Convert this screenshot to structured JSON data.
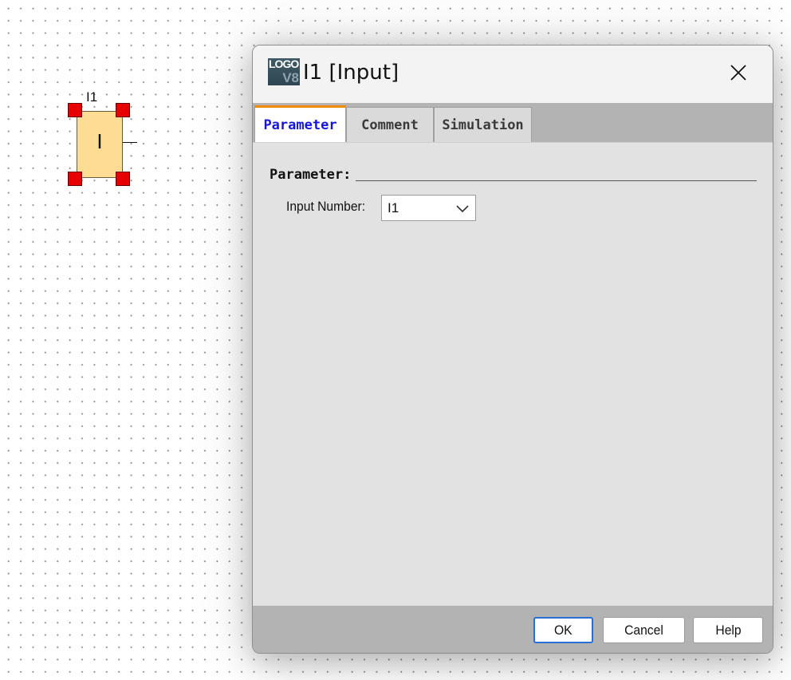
{
  "canvas": {
    "block": {
      "name": "I1",
      "symbol": "I"
    }
  },
  "dialog": {
    "icon": {
      "logo_text": "LOGO",
      "version_text": "V8"
    },
    "title": "I1 [Input]",
    "tabs": [
      {
        "label": "Parameter",
        "active": true
      },
      {
        "label": "Comment",
        "active": false
      },
      {
        "label": "Simulation",
        "active": false
      }
    ],
    "parameter_group": {
      "title": "Parameter:",
      "input_number_label": "Input Number:",
      "input_number_value": "I1"
    },
    "buttons": {
      "ok": "OK",
      "cancel": "Cancel",
      "help": "Help"
    }
  },
  "colors": {
    "block_fill": "#fddc94",
    "handle": "#e60000",
    "active_tab_text": "#1515e0",
    "active_tab_accent": "#f08a00",
    "ok_focus": "#2a6fd6"
  }
}
